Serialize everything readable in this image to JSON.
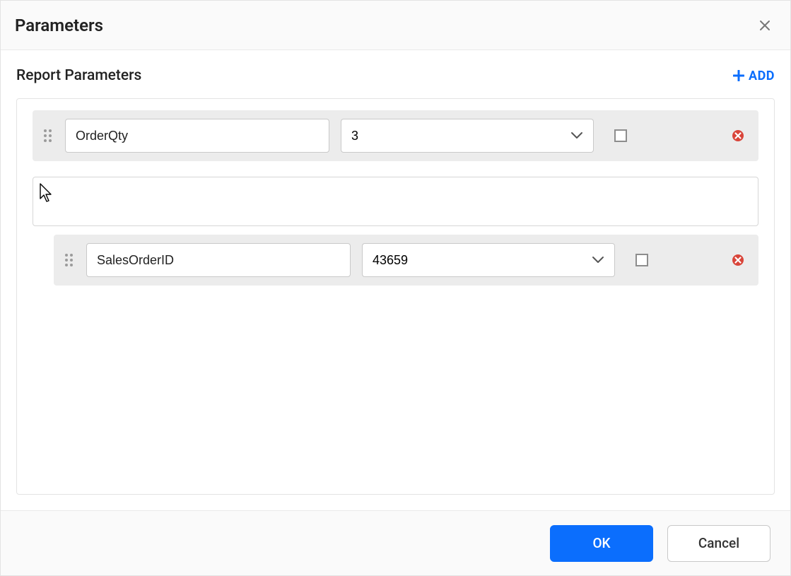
{
  "dialog": {
    "title": "Parameters"
  },
  "section": {
    "title": "Report Parameters",
    "add_label": "ADD"
  },
  "params": [
    {
      "name": "OrderQty",
      "value": "3",
      "checked": false
    },
    {
      "name": "SalesOrderID",
      "value": "43659",
      "checked": false
    }
  ],
  "footer": {
    "ok_label": "OK",
    "cancel_label": "Cancel"
  }
}
